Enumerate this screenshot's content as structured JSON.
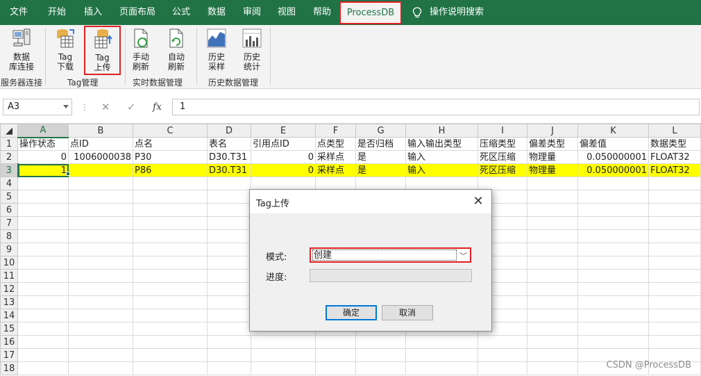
{
  "ribbon_tabs": [
    {
      "label": "文件"
    },
    {
      "label": "开始"
    },
    {
      "label": "插入"
    },
    {
      "label": "页面布局"
    },
    {
      "label": "公式"
    },
    {
      "label": "数据"
    },
    {
      "label": "审阅"
    },
    {
      "label": "视图"
    },
    {
      "label": "帮助"
    }
  ],
  "active_tab": "ProcessDB",
  "tell_me": "操作说明搜索",
  "ribbon": {
    "buttons": {
      "db_connect": "数据\n库连接",
      "tag_download": "Tag\n下载",
      "tag_upload": "Tag\n上传",
      "manual_refresh": "手动\n刷新",
      "auto_refresh": "自动\n刷新",
      "hist_sample": "历史\n采样",
      "hist_stats": "历史\n统计"
    },
    "groups": {
      "server": "服务器连接",
      "tag": "Tag管理",
      "realtime": "实时数据管理",
      "history": "历史数据管理"
    }
  },
  "formula_bar": {
    "name_box": "A3",
    "fx": "fx",
    "value": "1"
  },
  "sheet": {
    "columns": [
      "A",
      "B",
      "C",
      "D",
      "E",
      "F",
      "G",
      "H",
      "I",
      "J",
      "K",
      "L"
    ],
    "row_numbers": [
      "1",
      "2",
      "3",
      "4",
      "5",
      "6",
      "7",
      "8",
      "9",
      "10",
      "11",
      "12",
      "13",
      "14",
      "15",
      "16",
      "17",
      "18"
    ],
    "rows": [
      [
        "操作状态",
        "点ID",
        "点名",
        "表名",
        "引用点ID",
        "点类型",
        "是否归档",
        "输入输出类型",
        "压缩类型",
        "偏差类型",
        "偏差值",
        "数据类型"
      ],
      [
        "0",
        "1006000038",
        "P30",
        "D30.T31",
        "0",
        "采样点",
        "是",
        "输入",
        "死区压缩",
        "物理量",
        "0.050000001",
        "FLOAT32"
      ],
      [
        "1",
        "",
        "P86",
        "D30.T31",
        "0",
        "采样点",
        "是",
        "输入",
        "死区压缩",
        "物理量",
        "0.050000001",
        "FLOAT32"
      ]
    ]
  },
  "dialog": {
    "title": "Tag上传",
    "mode_label": "模式:",
    "mode_value": "创建",
    "progress_label": "进度:",
    "progress": 0,
    "ok": "确定",
    "cancel": "取消",
    "close": "✕"
  },
  "watermark": "CSDN @ProcessDB",
  "colors": {
    "excel_green": "#217346",
    "highlight_yellow": "#ffff00",
    "annotation_red": "#e02020"
  }
}
